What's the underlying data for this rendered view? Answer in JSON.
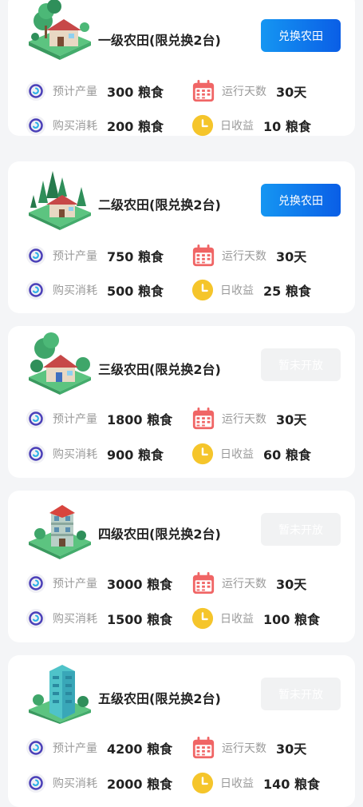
{
  "farms": [
    {
      "title": "一级农田(限兑换2台)",
      "button_label": "兑换农田",
      "button_state": "active",
      "icon": "farmhouse-small-icon",
      "expected_output_label": "预计产量",
      "expected_output_value": "300 粮食",
      "run_days_label": "运行天数",
      "run_days_value": "30天",
      "purchase_cost_label": "购买消耗",
      "purchase_cost_value": "200 粮食",
      "daily_income_label": "日收益",
      "daily_income_value": "10 粮食"
    },
    {
      "title": "二级农田(限兑换2台)",
      "button_label": "兑换农田",
      "button_state": "active",
      "icon": "farmhouse-forest-icon",
      "expected_output_label": "预计产量",
      "expected_output_value": "750 粮食",
      "run_days_label": "运行天数",
      "run_days_value": "30天",
      "purchase_cost_label": "购买消耗",
      "purchase_cost_value": "500 粮食",
      "daily_income_label": "日收益",
      "daily_income_value": "25 粮食"
    },
    {
      "title": "三级农田(限兑换2台)",
      "button_label": "暂未开放",
      "button_state": "disabled",
      "icon": "cottage-icon",
      "expected_output_label": "预计产量",
      "expected_output_value": "1800 粮食",
      "run_days_label": "运行天数",
      "run_days_value": "30天",
      "purchase_cost_label": "购买消耗",
      "purchase_cost_value": "900 粮食",
      "daily_income_label": "日收益",
      "daily_income_value": "60 粮食"
    },
    {
      "title": "四级农田(限兑换2台)",
      "button_label": "暂未开放",
      "button_state": "disabled",
      "icon": "townhouse-icon",
      "expected_output_label": "预计产量",
      "expected_output_value": "3000 粮食",
      "run_days_label": "运行天数",
      "run_days_value": "30天",
      "purchase_cost_label": "购买消耗",
      "purchase_cost_value": "1500 粮食",
      "daily_income_label": "日收益",
      "daily_income_value": "100 粮食"
    },
    {
      "title": "五级农田(限兑换2台)",
      "button_label": "暂未开放",
      "button_state": "disabled",
      "icon": "office-tower-icon",
      "expected_output_label": "预计产量",
      "expected_output_value": "4200 粮食",
      "run_days_label": "运行天数",
      "run_days_value": "30天",
      "purchase_cost_label": "购买消耗",
      "purchase_cost_value": "2000 粮食",
      "daily_income_label": "日收益",
      "daily_income_value": "140 粮食"
    }
  ],
  "colors": {
    "button_active_start": "#1596f2",
    "button_active_end": "#0a5ee6",
    "button_disabled": "#f1f2f3",
    "calendar_icon": "#f06565",
    "clock_icon": "#f5c52b",
    "coin_icon": "#4a3fb8"
  },
  "icons": {
    "expected_output": "coin-circle-icon",
    "purchase_cost": "coin-circle-icon",
    "run_days": "calendar-icon",
    "daily_income": "clock-icon"
  }
}
